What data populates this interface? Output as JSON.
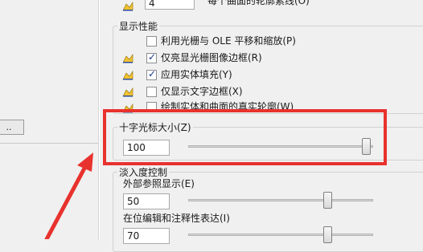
{
  "top_row": {
    "value": "4",
    "label": "每个曲面的轮廓素线(O)"
  },
  "display_performance": {
    "title": "显示性能",
    "items": [
      {
        "label": "利用光栅与 OLE 平移和缩放(P)",
        "checked": false,
        "icon": false
      },
      {
        "label": "仅亮显光栅图像边框(R)",
        "checked": true,
        "icon": true
      },
      {
        "label": "应用实体填充(Y)",
        "checked": true,
        "icon": true
      },
      {
        "label": "仅显示文字边框(X)",
        "checked": false,
        "icon": true
      },
      {
        "label": "绘制实体和曲面的真实轮廓(W)",
        "checked": false,
        "icon": true
      }
    ]
  },
  "crosshair": {
    "title": "十字光标大小(Z)",
    "value": "100",
    "slider_fraction": 1.0
  },
  "fade": {
    "title": "淡入度控制",
    "xref": {
      "label": "外部参照显示(E)",
      "value": "50",
      "slider_fraction": 0.7
    },
    "inplace": {
      "label": "在位编辑和注释性表达(I)",
      "value": "70",
      "slider_fraction": 0.7
    }
  },
  "left_button": {
    "label": ".."
  },
  "colors": {
    "highlight": "#e8322e",
    "arrow": "#e8322e"
  }
}
